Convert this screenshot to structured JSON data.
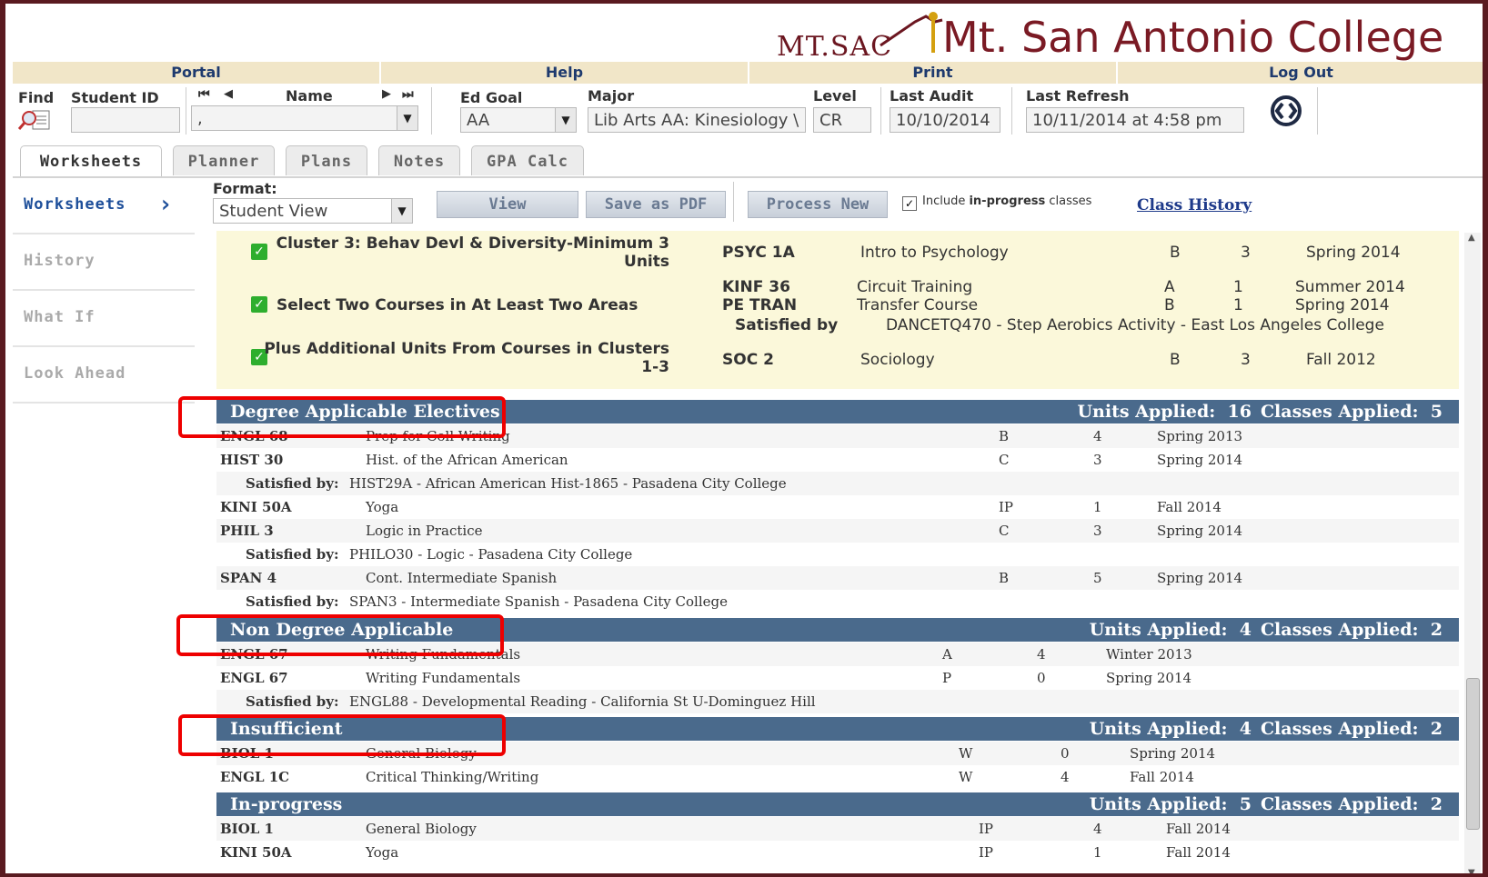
{
  "brand": {
    "short": "MT.SAC",
    "college": "Mt. San Antonio College"
  },
  "topnav": [
    "Portal",
    "Help",
    "Print",
    "Log Out"
  ],
  "search": {
    "find_label": "Find",
    "student_id_label": "Student ID",
    "student_id_value": "",
    "name_label": "Name",
    "name_value": ",",
    "ed_goal_label": "Ed Goal",
    "ed_goal_value": "AA",
    "major_label": "Major",
    "major_value": "Lib Arts AA: Kinesiology \\",
    "level_label": "Level",
    "level_value": "CR",
    "last_audit_label": "Last Audit",
    "last_audit_value": "10/10/2014",
    "last_refresh_label": "Last Refresh",
    "last_refresh_value": "10/11/2014 at 4:58 pm"
  },
  "tabs": [
    "Worksheets",
    "Planner",
    "Plans",
    "Notes",
    "GPA Calc"
  ],
  "sidenav": [
    "Worksheets",
    "History",
    "What If",
    "Look Ahead"
  ],
  "toolbar": {
    "format_label": "Format:",
    "format_value": "Student View",
    "view": "View",
    "save_pdf": "Save as PDF",
    "process_new": "Process New",
    "include_prefix": "Include ",
    "include_bold": "in-progress",
    "include_suffix": " classes",
    "class_history": "Class History"
  },
  "requirements": [
    {
      "title_line1": "Cluster 3: Behav Devl & Diversity-Minimum 3",
      "title_line2": "Units"
    },
    {
      "title_line1": "Select Two Courses in At Least Two Areas"
    },
    {
      "title_line1": "Plus Additional Units From Courses in Clusters",
      "title_line2": "1-3"
    }
  ],
  "req_courses": [
    {
      "code": "PSYC 1A",
      "title": "Intro to Psychology",
      "grade": "B",
      "units": "3",
      "term": "Spring 2014"
    },
    {
      "code": "KINF 36",
      "title": "Circuit Training",
      "grade": "A",
      "units": "1",
      "term": "Summer 2014"
    },
    {
      "code": "PE TRAN",
      "title": "Transfer Course",
      "grade": "B",
      "units": "1",
      "term": "Spring 2014"
    },
    {
      "code": "SOC 2",
      "title": "Sociology",
      "grade": "B",
      "units": "3",
      "term": "Fall 2012"
    }
  ],
  "req_satisfied": {
    "label": "Satisfied by",
    "text": "DANCETQ470 - Step Aerobics Activity - East Los Angeles College"
  },
  "units_label": "Units Applied:",
  "classes_label": "Classes Applied:",
  "satisfied_label": "Satisfied by:",
  "sections": [
    {
      "name": "Degree Applicable Electives",
      "units": "16",
      "classes": "5",
      "rows": [
        {
          "code": "ENGL 68",
          "title": "Prep for Coll Writing",
          "grade": "B",
          "units": "4",
          "term": "Spring 2013"
        },
        {
          "code": "HIST 30",
          "title": "Hist. of the African American",
          "grade": "C",
          "units": "3",
          "term": "Spring 2014"
        },
        {
          "sat": "HIST29A - African American Hist-1865 - Pasadena City College"
        },
        {
          "code": "KINI 50A",
          "title": "Yoga",
          "grade": "IP",
          "units": "1",
          "term": "Fall 2014"
        },
        {
          "code": "PHIL 3",
          "title": "Logic in Practice",
          "grade": "C",
          "units": "3",
          "term": "Spring 2014"
        },
        {
          "sat": "PHILO30 - Logic - Pasadena City College"
        },
        {
          "code": "SPAN 4",
          "title": "Cont. Intermediate Spanish",
          "grade": "B",
          "units": "5",
          "term": "Spring 2014"
        },
        {
          "sat": "SPAN3 - Intermediate Spanish - Pasadena City College"
        }
      ]
    },
    {
      "name": "Non Degree Applicable",
      "units": "4",
      "classes": "2",
      "rows": [
        {
          "code": "ENGL 67",
          "title": "Writing Fundamentals",
          "grade": "A",
          "units": "4",
          "term": "Winter 2013"
        },
        {
          "code": "ENGL 67",
          "title": "Writing Fundamentals",
          "grade": "P",
          "units": "0",
          "term": "Spring 2014"
        },
        {
          "sat": "ENGL88 - Developmental Reading - California St U-Dominguez Hill"
        }
      ]
    },
    {
      "name": "Insufficient",
      "units": "4",
      "classes": "2",
      "rows": [
        {
          "code": "BIOL 1",
          "title": "General Biology",
          "grade": "W",
          "units": "0",
          "term": "Spring 2014"
        },
        {
          "code": "ENGL 1C",
          "title": "Critical Thinking/Writing",
          "grade": "W",
          "units": "4",
          "term": "Fall 2014"
        }
      ]
    },
    {
      "name": "In-progress",
      "units": "5",
      "classes": "2",
      "rows": [
        {
          "code": "BIOL 1",
          "title": "General Biology",
          "grade": "IP",
          "units": "4",
          "term": "Fall 2014"
        },
        {
          "code": "KINI 50A",
          "title": "Yoga",
          "grade": "IP",
          "units": "1",
          "term": "Fall 2014"
        }
      ]
    }
  ]
}
